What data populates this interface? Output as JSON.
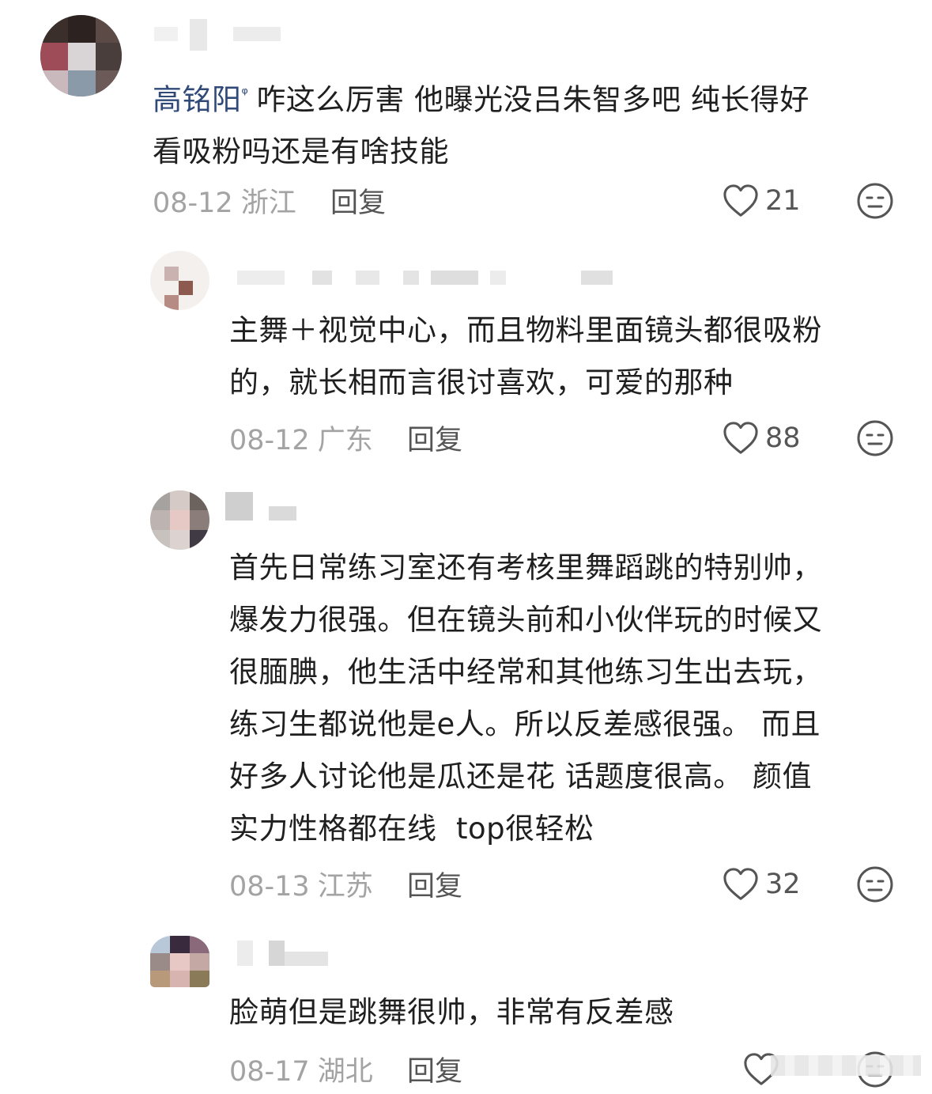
{
  "colors": {
    "text": "#1f1f1f",
    "meta": "#a3a3a3",
    "mention": "#2f4a78",
    "icon": "#555555"
  },
  "comments": [
    {
      "mention": "高铭阳",
      "mention_icon": "search-icon",
      "lines": [
        "咋这么厉害 他曝光没吕朱智多吧 纯长得好",
        "看吸粉吗还是有啥技能"
      ],
      "date": "08-12",
      "location": "浙江",
      "reply_label": "回复",
      "likes": "21"
    },
    {
      "lines": [
        "主舞＋视觉中心，而且物料里面镜头都很吸粉",
        "的，就长相而言很讨喜欢，可爱的那种"
      ],
      "date": "08-12",
      "location": "广东",
      "reply_label": "回复",
      "likes": "88"
    },
    {
      "lines": [
        "首先日常练习室还有考核里舞蹈跳的特别帅，",
        "爆发力很强。但在镜头前和小伙伴玩的时候又",
        "很腼腆，他生活中经常和其他练习生出去玩，",
        "练习生都说他是e人。所以反差感很强。 而且",
        "好多人讨论他是瓜还是花 话题度很高。 颜值",
        "实力性格都在线  top很轻松"
      ],
      "date": "08-13",
      "location": "江苏",
      "reply_label": "回复",
      "likes": "32"
    },
    {
      "lines": [
        "脸萌但是跳舞很帅，非常有反差感"
      ],
      "date": "08-17",
      "location": "湖北",
      "reply_label": "回复",
      "likes": ""
    }
  ]
}
